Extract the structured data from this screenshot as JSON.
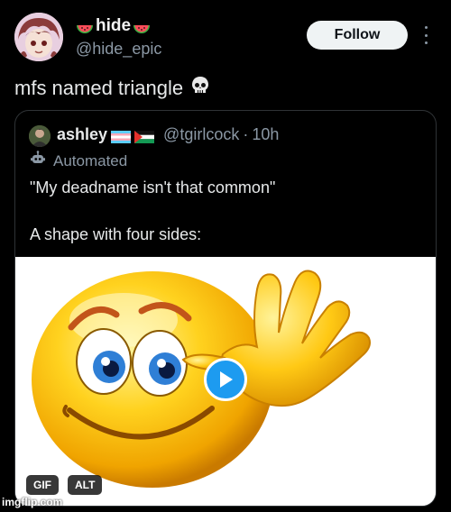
{
  "author": {
    "display_name": "hide",
    "handle": "@hide_epic"
  },
  "actions": {
    "follow_label": "Follow",
    "more_icon": "more-vertical-icon"
  },
  "post": {
    "text": "mfs named triangle",
    "emoji_icon": "skull-icon"
  },
  "quoted": {
    "display_name": "ashley",
    "handle": "@tgirlcock",
    "separator": "·",
    "time": "10h",
    "badge_label": "Automated",
    "line1": "\"My deadname isn't that common\"",
    "line2": "A shape with four sides:",
    "media": {
      "gif_badge": "GIF",
      "alt_badge": "ALT",
      "play_icon": "play-icon"
    }
  },
  "watermark": "imgflip.com",
  "colors": {
    "follow_bg": "#eff3f4",
    "muted_text": "#8b98a5",
    "play_blue": "#1d9bf0",
    "border": "#2f3336"
  }
}
